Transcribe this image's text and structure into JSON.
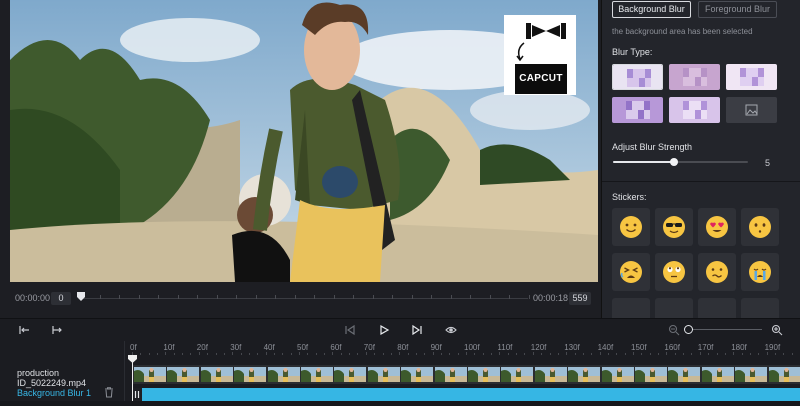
{
  "preview": {
    "current_time": "00:00:00",
    "current_frame": "0",
    "total_time": "00:00:18",
    "total_frames": "559",
    "logo_text": "CAPCUT"
  },
  "blur_panel": {
    "tabs": [
      "Background Blur",
      "Foreground Blur"
    ],
    "selected_note": "the background area has been selected",
    "blur_type_label": "Blur Type:",
    "blur_types": [
      "blur-type-1",
      "blur-type-2",
      "blur-type-3",
      "blur-type-4",
      "blur-type-5",
      "custom-image"
    ],
    "selected_blur_type": 0,
    "strength_label": "Adjust Blur Strength",
    "strength_value": "5",
    "strength_fraction": 0.45,
    "stickers_label": "Stickers:",
    "stickers": [
      "smile-emoji",
      "sunglasses-emoji",
      "heart-eyes-emoji",
      "neutral-emoji",
      "tired-emoji",
      "rolling-eyes-emoji",
      "grimace-emoji",
      "crying-emoji"
    ]
  },
  "timeline": {
    "ruler_labels": [
      "0f",
      "10f",
      "20f",
      "30f",
      "40f",
      "50f",
      "60f",
      "70f",
      "80f",
      "90f",
      "100f",
      "110f",
      "120f",
      "130f",
      "140f",
      "150f",
      "160f",
      "170f",
      "180f",
      "190f"
    ],
    "tracks": {
      "main": "production ID_5022249.mp4",
      "blur": "Background Blur 1"
    }
  },
  "colors": {
    "accent": "#36b6e4",
    "panel_bg": "#23252b",
    "app_bg": "#17181c"
  }
}
